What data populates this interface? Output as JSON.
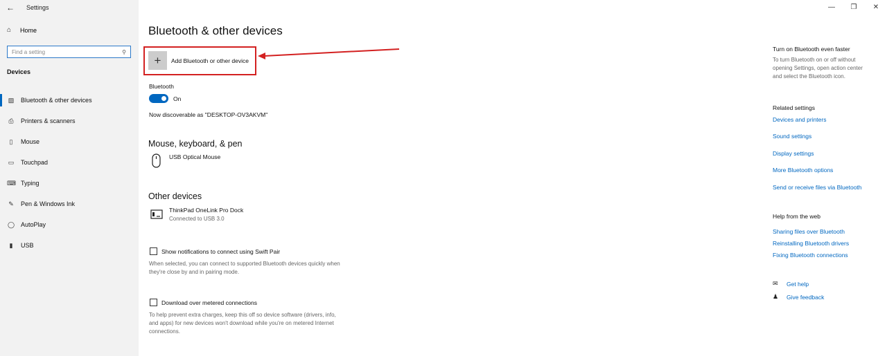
{
  "window": {
    "app_title": "Settings",
    "controls": {
      "minimize": "—",
      "restore": "❐",
      "close": "✕"
    }
  },
  "sidebar": {
    "home_label": "Home",
    "search_placeholder": "Find a setting",
    "section_label": "Devices",
    "items": [
      {
        "label": "Bluetooth & other devices",
        "icon": "bluetooth-devices-icon",
        "active": true
      },
      {
        "label": "Printers & scanners",
        "icon": "printer-icon",
        "active": false
      },
      {
        "label": "Mouse",
        "icon": "mouse-icon",
        "active": false
      },
      {
        "label": "Touchpad",
        "icon": "touchpad-icon",
        "active": false
      },
      {
        "label": "Typing",
        "icon": "keyboard-icon",
        "active": false
      },
      {
        "label": "Pen & Windows Ink",
        "icon": "pen-icon",
        "active": false
      },
      {
        "label": "AutoPlay",
        "icon": "autoplay-icon",
        "active": false
      },
      {
        "label": "USB",
        "icon": "usb-icon",
        "active": false
      }
    ]
  },
  "main": {
    "title": "Bluetooth & other devices",
    "add_device_label": "Add Bluetooth or other device",
    "bluetooth_label": "Bluetooth",
    "bluetooth_state": "On",
    "discoverable_text": "Now discoverable as \"DESKTOP-OV3AKVM\"",
    "mouse_section_title": "Mouse, keyboard, & pen",
    "mouse_device_name": "USB Optical Mouse",
    "other_section_title": "Other devices",
    "other_device_name": "ThinkPad OneLink Pro Dock",
    "other_device_status": "Connected to USB 3.0",
    "swift_pair_label": "Show notifications to connect using Swift Pair",
    "swift_pair_desc": "When selected, you can connect to supported Bluetooth devices quickly when they're close by and in pairing mode.",
    "metered_label": "Download over metered connections",
    "metered_desc": "To help prevent extra charges, keep this off so device software (drivers, info, and apps) for new devices won't download while you're on metered Internet connections."
  },
  "right_panel": {
    "tip_title": "Turn on Bluetooth even faster",
    "tip_text": "To turn Bluetooth on or off without opening Settings, open action center and select the Bluetooth icon.",
    "related_title": "Related settings",
    "related_links": [
      "Devices and printers",
      "Sound settings",
      "Display settings",
      "More Bluetooth options",
      "Send or receive files via Bluetooth"
    ],
    "help_title": "Help from the web",
    "help_links": [
      "Sharing files over Bluetooth",
      "Reinstalling Bluetooth drivers",
      "Fixing Bluetooth connections"
    ],
    "get_help": "Get help",
    "give_feedback": "Give feedback"
  },
  "colors": {
    "accent": "#0067c0",
    "annotation_red": "#d32020",
    "sidebar_bg": "#f2f2f2"
  }
}
